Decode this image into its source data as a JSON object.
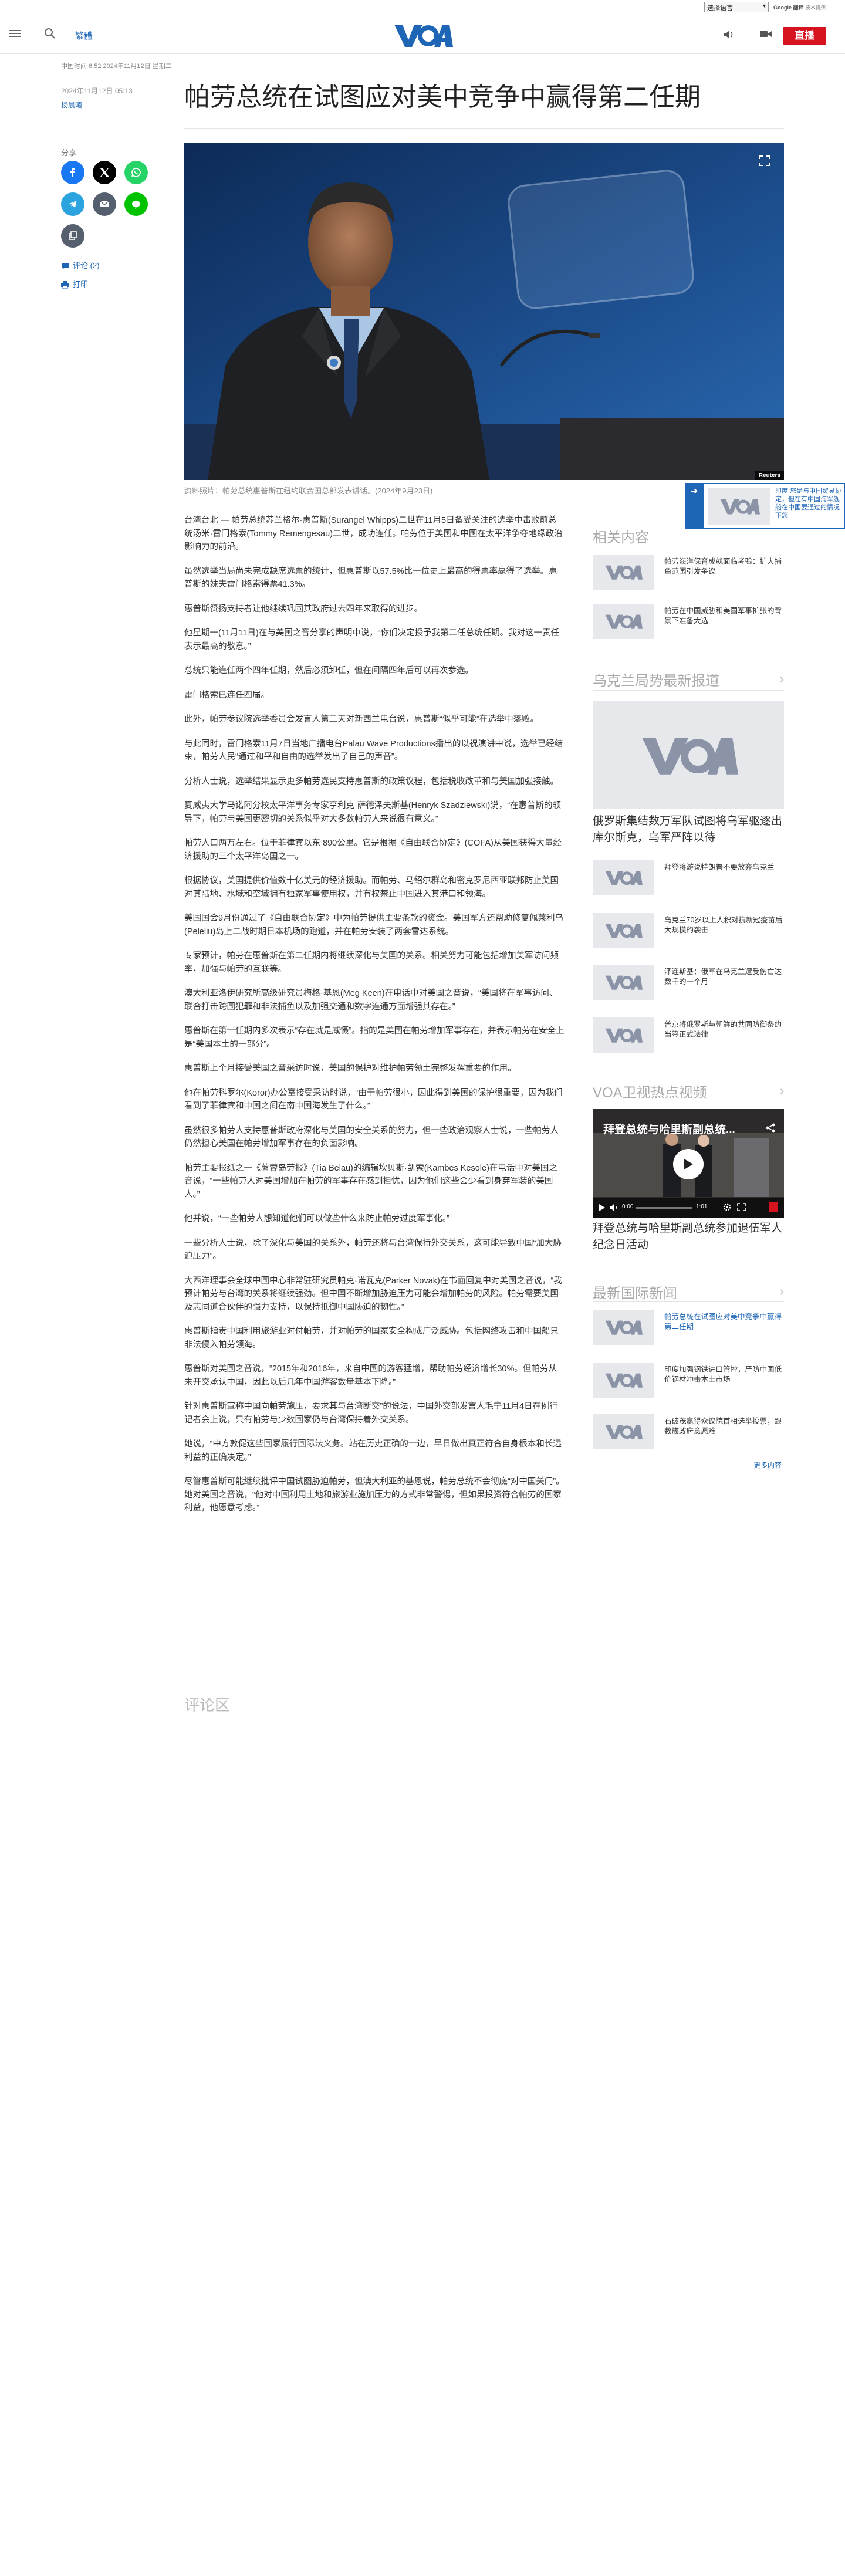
{
  "translate_bar": {
    "select_label": "选择语言",
    "powered_by": "Google 翻译",
    "powered_suffix": "技术提供"
  },
  "header": {
    "traditional": "繁體",
    "live": "直播",
    "logo": "VOA"
  },
  "breadcrumb": "中国时间 6:52 2024年11月12日 星期二",
  "article": {
    "date": "2024年11月12日 05:13",
    "author": "杨晨曦",
    "title": "帕劳总统在试图应对美中竞争中赢得第二任期",
    "share_label": "分享",
    "comments_link": "评论 (2)",
    "print_link": "打印",
    "photo_credit": "Reuters",
    "caption": "资料照片：帕劳总统惠普斯在纽约联合国总部发表讲话。(2024年9月23日)",
    "paragraphs": [
      "台湾台北 — 帕劳总统苏兰格尔·惠普斯(Surangel Whipps)二世在11月5日备受关注的选举中击败前总统汤米·雷门格索(Tommy Remengesau)二世，成功连任。帕劳位于美国和中国在太平洋争夺地缘政治影响力的前沿。",
      "虽然选举当局尚未完成缺席选票的统计，但惠普斯以57.5%比一位史上最高的得票率赢得了选举。惠普斯的妹夫雷门格索得票41.3%。",
      "惠普斯赞扬支持者让他继续巩固其政府过去四年来取得的进步。",
      "他星期一(11月11日)在与美国之音分享的声明中说，“你们决定授予我第二任总统任期。我对这一责任表示最高的敬意。”",
      "总统只能连任两个四年任期，然后必须卸任，但在间隔四年后可以再次参选。",
      "雷门格索已连任四届。",
      "此外，帕劳参议院选举委员会发言人第二天对新西兰电台说，惠普斯“似乎可能”在选举中落败。",
      "与此同时，雷门格索11月7日当地广播电台Palau Wave Productions播出的以祝演讲中说，选举已经结束，帕劳人民“通过和平和自由的选举发出了自己的声音”。",
      "分析人士说，选举结果显示更多帕劳选民支持惠普斯的政策议程，包括税收改革和与美国加强接触。",
      "夏威夷大学马诺阿分校太平洋事务专家亨利克·萨德泽夫斯基(Henryk Szadziewski)说，“在惠普斯的领导下，帕劳与美国更密切的关系似乎对大多数帕劳人来说很有意义。”",
      "帕劳人口两万左右。位于菲律宾以东 890公里。它是根据《自由联合协定》(COFA)从美国获得大量经济援助的三个太平洋岛国之一。",
      "根据协议，美国提供价值数十亿美元的经济援助。而帕劳、马绍尔群岛和密克罗尼西亚联邦防止美国对其陆地、水域和空域拥有独家军事使用权，并有权禁止中国进入其港口和领海。",
      "美国国会9月份通过了《自由联合协定》中为帕劳提供主要条款的资金。美国军方还帮助修复佩莱利乌(Peleliu)岛上二战时期日本机场的跑道，并在帕劳安装了两套雷达系统。",
      "专家预计，帕劳在惠普斯在第二任期内将继续深化与美国的关系。相关努力可能包括增加美军访问频率，加强与帕劳的互联等。",
      "澳大利亚洛伊研究所高级研究员梅格·基恩(Meg Keen)在电话中对美国之音说，“美国将在军事访问、联合打击跨国犯罪和非法捕鱼以及加强交通和数字连通方面增强其存在。”",
      "惠普斯在第一任期内多次表示“存在就是威慑”。指的是美国在帕劳增加军事存在，并表示帕劳在安全上是“美国本土的一部分”。",
      "惠普斯上个月接受美国之音采访时说，美国的保护对维护帕劳领土完整发挥重要的作用。",
      "他在帕劳科罗尔(Koror)办公室接受采访时说，“由于帕劳很小，因此得到美国的保护很重要，因为我们看到了菲律宾和中国之间在南中国海发生了什么。”",
      "虽然很多帕劳人支持惠普斯政府深化与美国的安全关系的努力，但一些政治观察人士说，一些帕劳人仍然担心美国在帕劳增加军事存在的负面影响。",
      "帕劳主要报纸之一《薯蓉岛劳报》(Tia Belau)的编辑坎贝斯·凯索(Kambes Kesole)在电话中对美国之音说，“一些帕劳人对美国增加在帕劳的军事存在感到担忧，因为他们这些会少看到身穿军装的美国人。”",
      "他并说，“一些帕劳人想知道他们可以做些什么来防止帕劳过度军事化。”",
      "一些分析人士说，除了深化与美国的关系外，帕劳还将与台湾保持外交关系，这可能导致中国“加大胁迫压力”。",
      "大西洋理事会全球中国中心非常驻研究员帕克·诺瓦克(Parker Novak)在书面回复中对美国之音说，“我预计帕劳与台湾的关系将继续强劲。但中国不断增加胁迫压力可能会增加帕劳的风险。帕劳需要美国及志同道合伙伴的强力支持，以保持抵御中国胁迫的韧性。”",
      "惠普斯指责中国利用旅游业对付帕劳，并对帕劳的国家安全构成广泛威胁。包括网络攻击和中国船只非法侵入帕劳领海。",
      "惠普斯对美国之音说，“2015年和2016年，来自中国的游客猛增，帮助帕劳经济增长30%。但帕劳从未开交承认中国，因此以后几年中国游客数量基本下降。”",
      "针对惠普斯宣称中国向帕劳施压，要求其与台湾断交”的说法，中国外交部发言人毛宁11月4日在例行记者会上说，只有帕劳与少数国家仍与台湾保持着外交关系。",
      "她说，“中方敦促这些国家履行国际法义务。站在历史正确的一边，早日做出真正符合自身根本和长远利益的正确决定。”",
      "尽管惠普斯可能继续批评中国试图胁迫帕劳，但澳大利亚的基恩说，帕劳总统不会彻底“对中国关门”。她对美国之音说，“他对中国利用土地和旅游业施加压力的方式非常警惕，但如果投资符合帕劳的国家利益，他愿意考虑。”"
    ],
    "comments_heading": "评论区"
  },
  "sidebar": {
    "related_title": "相关内容",
    "related": [
      "帕劳海洋保育成就面临考验：扩大捕鱼范围引发争议",
      "帕劳在中国威胁和美国军事扩张的背景下准备大选"
    ],
    "ukraine_title": "乌克兰局势最新报道",
    "ukraine_lead": "俄罗斯集结数万军队试图将乌军驱逐出库尔斯克，乌军严阵以待",
    "ukraine_items": [
      "拜登将游说特朗普不要放弃乌克兰",
      "乌克兰70岁以上人积对抗新冠疫苗后大规模的袭击",
      "泽连斯基：俄军在乌克兰遭受伤亡达数千的一个月",
      "普京将俄罗斯与朝鲜的共同防御条约当签正式法律"
    ],
    "video_title": "VOA卫视热点视频",
    "video_overlay_title": "拜登总统与哈里斯副总统...",
    "video_time_start": "0:00",
    "video_time_end": "1:01",
    "video_caption": "拜登总统与哈里斯副总统参加退伍军人纪念日活动",
    "latest_title": "最新国际新闻",
    "latest_items": [
      "帕劳总统在试图应对美中竞争中赢得第二任期",
      "印度加强钢铁进口管控，严防中国低价钢材冲击本土市场",
      "石破茂赢得众议院首相选举投票，跟数族政府意愿难"
    ],
    "more_link": "更多内容",
    "popup_text": "印度:您是与中国贸易协定，但在有中国海军舰船在中国要通过的情况下您"
  },
  "colors": {
    "brand_blue": "#1e66b5",
    "live_red": "#d6141f"
  }
}
